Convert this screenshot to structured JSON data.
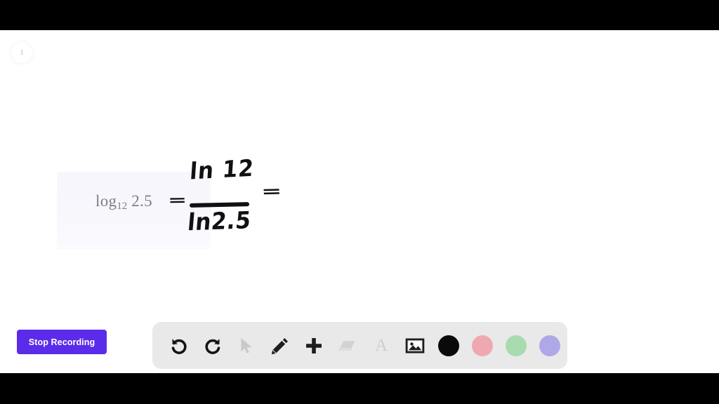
{
  "app": {
    "canvas_background": "#ffffff",
    "letterbox_color": "#000000"
  },
  "page_badge": {
    "number": "1"
  },
  "equation": {
    "printed": {
      "log_label": "log",
      "base": "12",
      "argument": "2.5",
      "highlight_color": "#f8f7fd",
      "text_color": "#7d7d85"
    },
    "handwritten": {
      "equals_1": "=",
      "numerator": "ln 12",
      "denominator": "ln2.5",
      "equals_2": "=",
      "ink_color": "#111114"
    }
  },
  "controls": {
    "stop_recording_label": "Stop Recording",
    "stop_recording_color": "#5b2bea"
  },
  "toolbar": {
    "background": "#e9e9e9",
    "tools": [
      {
        "name": "undo-icon",
        "label": "Undo",
        "state": "enabled"
      },
      {
        "name": "redo-icon",
        "label": "Redo",
        "state": "enabled"
      },
      {
        "name": "cursor-icon",
        "label": "Select",
        "state": "disabled"
      },
      {
        "name": "pencil-icon",
        "label": "Pen",
        "state": "enabled"
      },
      {
        "name": "plus-icon",
        "label": "Add",
        "state": "enabled"
      },
      {
        "name": "eraser-icon",
        "label": "Eraser",
        "state": "disabled"
      },
      {
        "name": "text-icon",
        "label": "A",
        "state": "disabled"
      },
      {
        "name": "image-icon",
        "label": "Insert image",
        "state": "enabled"
      }
    ],
    "colors": [
      {
        "name": "color-swatch-black",
        "label": "Black",
        "hex": "#0a0a0a"
      },
      {
        "name": "color-swatch-pink",
        "label": "Pink",
        "hex": "#f0a8b0"
      },
      {
        "name": "color-swatch-green",
        "label": "Green",
        "hex": "#a8dbb0"
      },
      {
        "name": "color-swatch-purple",
        "label": "Purple",
        "hex": "#afa8e8"
      }
    ]
  }
}
